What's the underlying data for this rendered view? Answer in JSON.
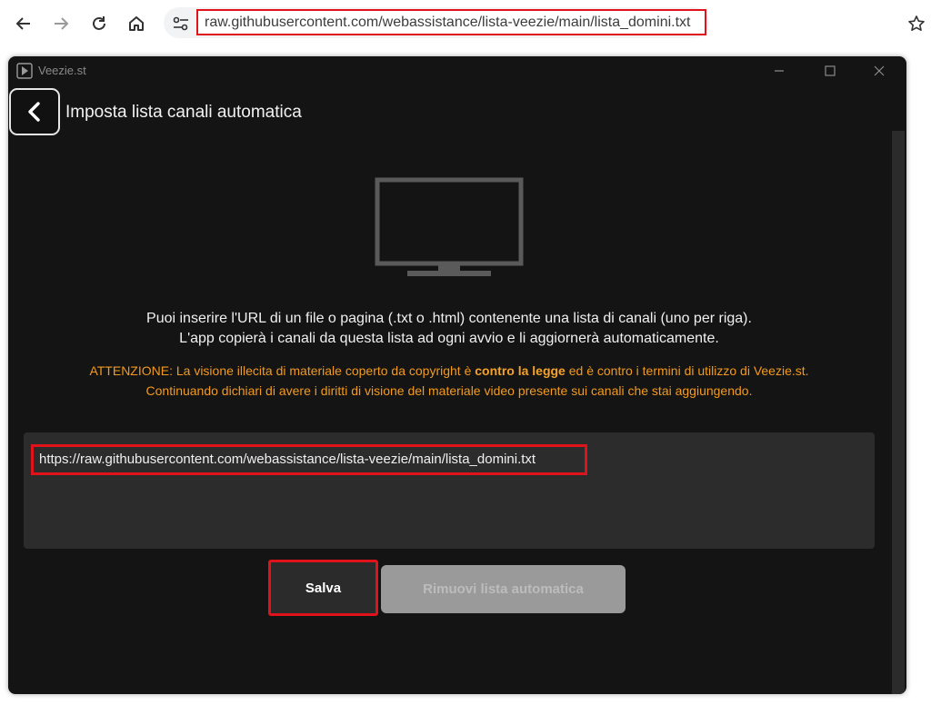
{
  "browser": {
    "address_url": "raw.githubusercontent.com/webassistance/lista-veezie/main/lista_domini.txt",
    "icons": [
      "back-arrow-icon",
      "forward-arrow-icon",
      "reload-icon",
      "home-icon",
      "site-settings-icon",
      "bookmark-star-icon"
    ]
  },
  "app": {
    "window_title": "Veezie.st",
    "page_title": "Imposta lista canali automatica",
    "info_line_1": "Puoi inserire l'URL di un file o pagina (.txt o .html) contenente una lista di canali (uno per riga).",
    "info_line_2": "L'app copierà i canali da questa lista ad ogni avvio e li aggiornerà automaticamente.",
    "warning_line_1_pre": "ATTENZIONE: La visione illecita di materiale coperto da copyright è ",
    "warning_line_1_bold": "contro la legge",
    "warning_line_1_post": " ed è contro i termini di utilizzo di Veezie.st.",
    "warning_line_2": "Continuando dichiari di avere i diritti di visione del materiale video presente sui canali che stai aggiungendo.",
    "url_input_value": "https://raw.githubusercontent.com/webassistance/lista-veezie/main/lista_domini.txt",
    "save_label": "Salva",
    "remove_label": "Rimuovi lista automatica"
  },
  "colors": {
    "highlight": "#e0131b",
    "warning": "#f39a1f",
    "window_bg": "#141414"
  }
}
